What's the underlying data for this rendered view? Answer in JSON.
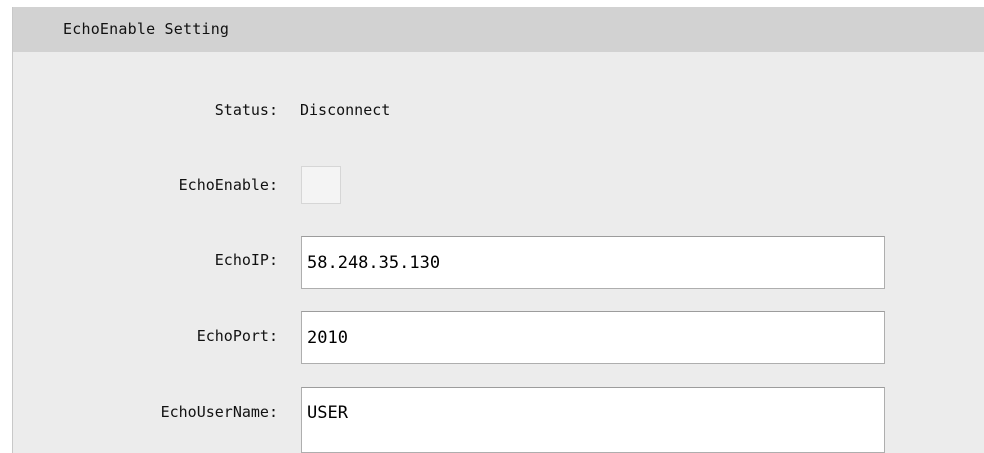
{
  "panel": {
    "title": "EchoEnable Setting"
  },
  "fields": {
    "status": {
      "label": "Status:",
      "value": "Disconnect"
    },
    "echo_enable": {
      "label": "EchoEnable:",
      "checked": false
    },
    "echo_ip": {
      "label": "EchoIP:",
      "value": "58.248.35.130"
    },
    "echo_port": {
      "label": "EchoPort:",
      "value": "2010"
    },
    "echo_user_name": {
      "label": "EchoUserName:",
      "value": "USER"
    }
  },
  "colors": {
    "panel_background": "#ececec",
    "header_background": "#d2d2d2",
    "input_background": "#ffffff",
    "input_border": "#aeaeae"
  }
}
